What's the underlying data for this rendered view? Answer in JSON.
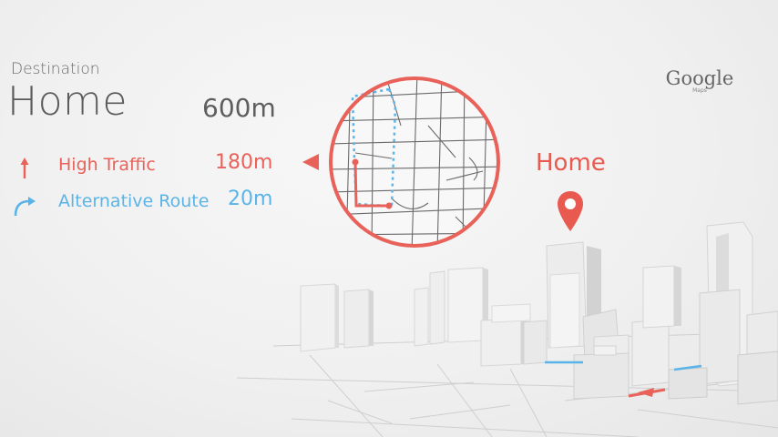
{
  "destination": {
    "label": "Destination",
    "name": "Home",
    "distance": "600m"
  },
  "routes": [
    {
      "icon": "arrow-up-icon",
      "label": "High Traffic",
      "distance": "180m",
      "color": "#e8625a"
    },
    {
      "icon": "turn-right-arrow-icon",
      "label": "Alternative Route",
      "distance": "20m",
      "color": "#5bb4e8"
    }
  ],
  "map_marker": {
    "label": "Home",
    "icon": "location-pin-icon",
    "color": "#e85a50"
  },
  "brand": {
    "logo_text": "Google",
    "sub_text": "Maps"
  },
  "colors": {
    "accent_red": "#e8625a",
    "accent_blue": "#5bb4e8",
    "text_gray": "#5a5a5a"
  }
}
